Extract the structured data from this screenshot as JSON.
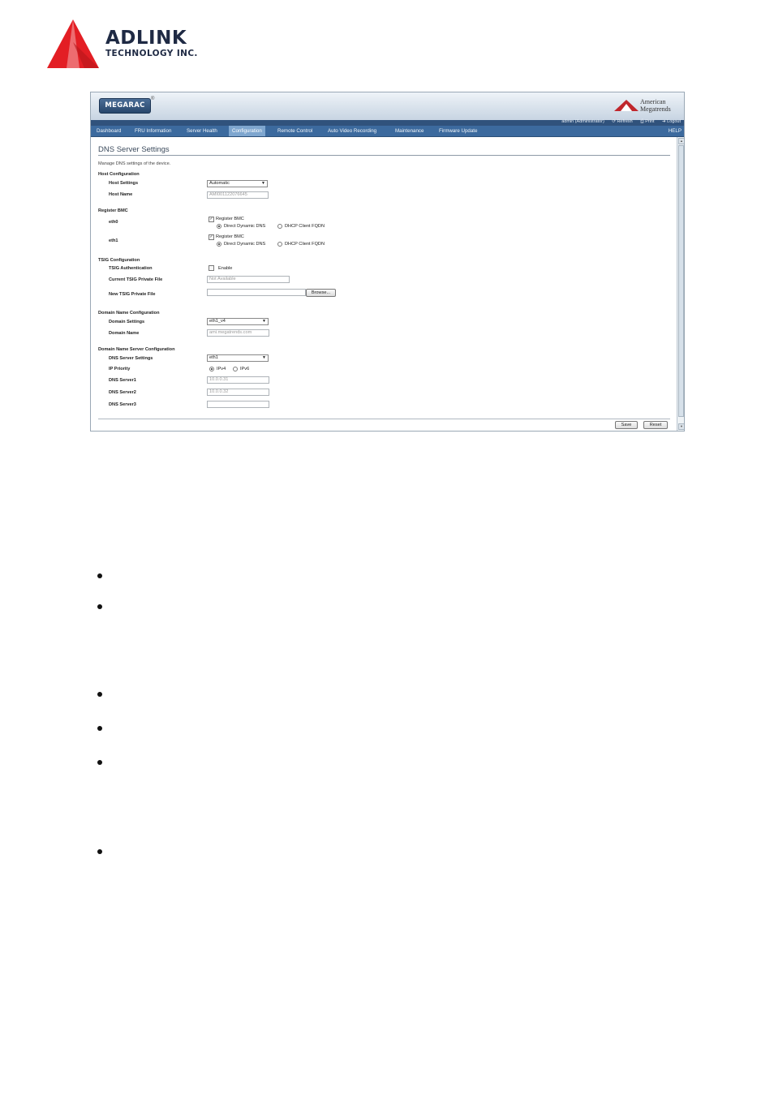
{
  "doc": {
    "logo": {
      "name": "ADLINK",
      "tagline": "TECHNOLOGY INC.",
      "color": "#e31e24"
    }
  },
  "app": {
    "brand": "MEGARAC",
    "vendor_line1": "American",
    "vendor_line2": "Megatrends",
    "util_links": [
      "admin (Administrator)",
      "Refresh",
      "Print",
      "Logout"
    ],
    "nav": [
      "Dashboard",
      "FRU Information",
      "Server Health",
      "Configuration",
      "Remote Control",
      "Auto Video Recording",
      "Maintenance",
      "Firmware Update"
    ],
    "help": "HELP",
    "active_nav": "Configuration"
  },
  "page": {
    "title": "DNS Server Settings",
    "description": "Manage DNS settings of the device.",
    "host": {
      "section": "Host Configuration",
      "settings_label": "Host Settings",
      "settings_value": "Automatic",
      "name_label": "Host Name",
      "name_value": "AMI001122076645"
    },
    "register": {
      "section": "Register BMC",
      "eth0": "eth0",
      "eth1": "eth1",
      "register_label": "Register BMC",
      "option_direct": "Direct Dynamic DNS",
      "option_dhcp": "DHCP Client FQDN"
    },
    "tsig": {
      "section": "TSIG Configuration",
      "auth_label": "TSIG Authentication",
      "enable_label": "Enable",
      "current_label": "Current TSIG Private File",
      "current_value": "Not Available",
      "new_label": "New TSIG Private File",
      "browse": "Browse..."
    },
    "domain": {
      "section": "Domain Name Configuration",
      "settings_label": "Domain Settings",
      "settings_value": "eth1_v4",
      "name_label": "Domain Name",
      "name_value": "ami.megatrends.com"
    },
    "dns": {
      "section": "Domain Name Server Configuration",
      "settings_label": "DNS Server Settings",
      "settings_value": "eth1",
      "priority_label": "IP Priority",
      "ipv4": "IPv4",
      "ipv6": "IPv6",
      "server1_label": "DNS Server1",
      "server1_value": "10.0.0.31",
      "server2_label": "DNS Server2",
      "server2_value": "10.0.0.32",
      "server3_label": "DNS Server3",
      "server3_value": ""
    },
    "buttons": {
      "save": "Save",
      "reset": "Reset"
    }
  },
  "bullets_count": 6
}
